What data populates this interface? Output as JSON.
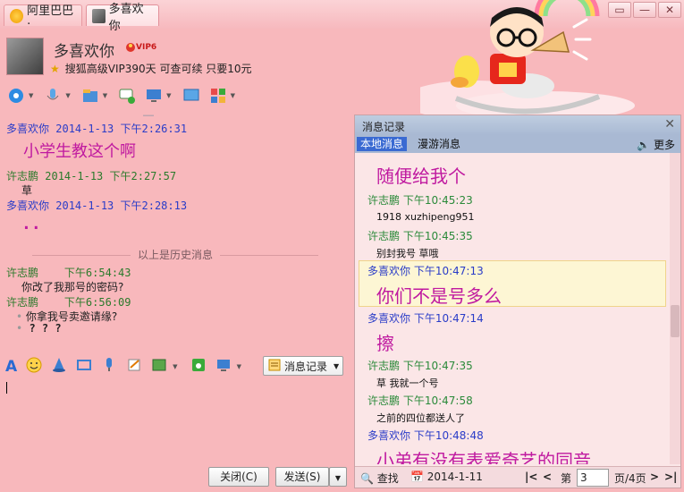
{
  "window": {
    "tabs": [
      {
        "label": "阿里巴巴·"
      },
      {
        "label": "多喜欢你"
      }
    ],
    "controls": [
      "▭",
      "—",
      "✕"
    ]
  },
  "header": {
    "contact_name": "多喜欢你",
    "vip_badge": "VIP6",
    "promo_text": "搜狐高级VIP390天 可查可续 只要10元"
  },
  "chat": {
    "partial_top": "……",
    "messages": [
      {
        "sender": "多喜欢你",
        "time": "2014-1-13 下午2:26:31",
        "text": "小学生教这个啊"
      },
      {
        "sender": "许志鹏",
        "time": "2014-1-13 下午2:27:57",
        "text": "草"
      },
      {
        "sender": "多喜欢你",
        "time": "2014-1-13 下午2:28:13",
        "text": ".."
      },
      {
        "sender": "许志鹏",
        "time": "下午6:54:43",
        "text": "你改了我那号的密码?"
      },
      {
        "sender": "许志鹏",
        "time": "下午6:56:09",
        "text": "你拿我号卖邀请缘?"
      },
      {
        "sender": "",
        "time": "",
        "text": "? ? ?"
      }
    ],
    "history_separator": "以上是历史消息"
  },
  "input_toolbar": {
    "history_button": "消息记录"
  },
  "buttons": {
    "close": "关闭(C)",
    "send": "发送(S)"
  },
  "record": {
    "title": "消息记录",
    "tabs": [
      "本地消息",
      "漫游消息"
    ],
    "more": "更多",
    "entries": [
      {
        "sender": "",
        "time": "",
        "text": "随便给我个"
      },
      {
        "sender": "许志鹏",
        "time": "下午10:45:23",
        "text": "1918 xuzhipeng951"
      },
      {
        "sender": "许志鹏",
        "time": "下午10:45:35",
        "text": "别封我号 草哦"
      },
      {
        "sender": "多喜欢你",
        "time": "下午10:47:13",
        "text": "你们不是号多么"
      },
      {
        "sender": "多喜欢你",
        "time": "下午10:47:14",
        "text": "擦"
      },
      {
        "sender": "许志鹏",
        "time": "下午10:47:35",
        "text": "草 我就一个号"
      },
      {
        "sender": "许志鹏",
        "time": "下午10:47:58",
        "text": "之前的四位都送人了"
      },
      {
        "sender": "多喜欢你",
        "time": "下午10:48:48",
        "text": "小弟有没有表爱奇艺的同音"
      }
    ],
    "footer": {
      "search": "查找",
      "date": "2014-1-11",
      "page_label": "第",
      "page_value": "3",
      "page_total": "页/4页"
    }
  },
  "colors": {
    "background": "#f8b8bc",
    "sender_blue": "#2a3cc8",
    "sender_green": "#2b7a2b",
    "message_magenta": "#c01aa0",
    "record_header": "#a9b9d3"
  }
}
